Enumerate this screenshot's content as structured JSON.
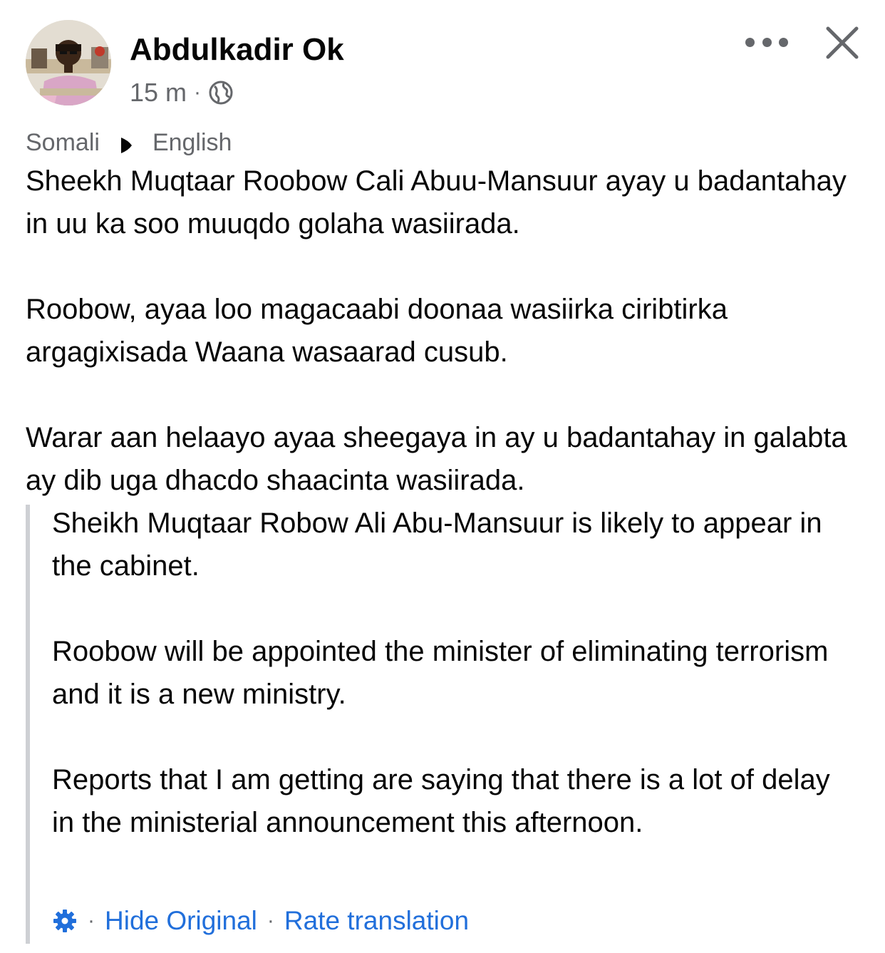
{
  "post": {
    "author_name": "Abdulkadir Ok",
    "timestamp": "15 m",
    "separator": "·",
    "audience_icon": "globe-icon",
    "more_icon": "more-options-icon",
    "close_icon": "close-icon"
  },
  "language": {
    "source": "Somali",
    "arrow_icon": "play-arrow-icon",
    "target": "English"
  },
  "original_text": {
    "paragraphs": [
      "Sheekh Muqtaar Roobow Cali Abuu-Mansuur ayay u badantahay in uu ka soo muuqdo golaha wasiirada.",
      "Roobow, ayaa loo magacaabi doonaa wasiirka ciribtirka argagixisada Waana wasaarad cusub.",
      "Warar aan helaayo ayaa sheegaya in ay u badantahay in galabta ay dib uga dhacdo shaacinta wasiirada."
    ]
  },
  "translated_text": {
    "paragraphs": [
      "Sheikh Muqtaar Robow Ali Abu-Mansuur is likely to appear in the cabinet.",
      "Roobow will be appointed the minister of eliminating terrorism and it is a new ministry.",
      "Reports that I am getting are saying that there is a lot of delay in the ministerial announcement this afternoon."
    ]
  },
  "translation_actions": {
    "settings_icon": "gear-icon",
    "separator": "·",
    "hide_original_label": "Hide Original",
    "rate_translation_label": "Rate translation"
  },
  "colors": {
    "text_primary": "#050505",
    "text_secondary": "#65676b",
    "link": "#216fdb",
    "quote_border": "#ced0d4"
  }
}
